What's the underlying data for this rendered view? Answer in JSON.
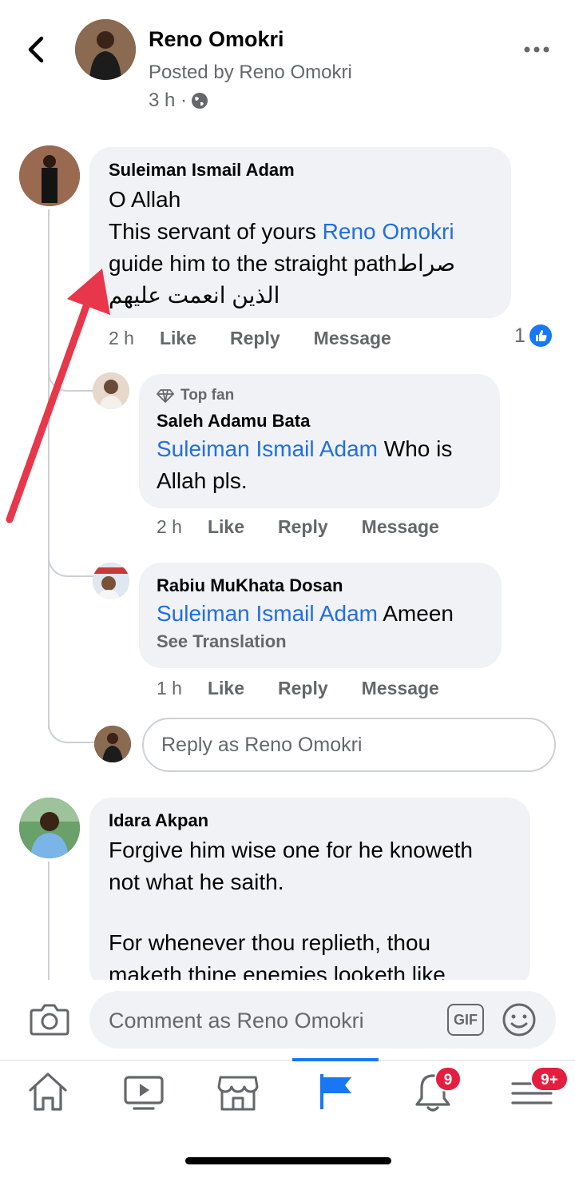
{
  "header": {
    "name": "Reno Omokri",
    "posted_by": "Posted by Reno Omokri",
    "time": "3 h ·"
  },
  "comments": [
    {
      "name": "Suleiman Ismail Adam",
      "line1": "O Allah",
      "line2_pre": "This servant of yours ",
      "line2_link": "Reno Omokri",
      "line3": "guide him to the straight pathصراط",
      "line4": "الذين انعمت عليهم",
      "time": "2 h",
      "like": "Like",
      "reply": "Reply",
      "message": "Message",
      "like_count": "1"
    },
    {
      "top_fan": "Top fan",
      "name": "Saleh Adamu Bata",
      "mention": "Suleiman Ismail Adam",
      "text_after": " Who is",
      "text_line2": "Allah pls.",
      "time": "2 h",
      "like": "Like",
      "reply": "Reply",
      "message": "Message"
    },
    {
      "name": "Rabiu MuKhata Dosan",
      "mention": "Suleiman Ismail Adam",
      "text_after": " Ameen",
      "see_translation": "See Translation",
      "time": "1 h",
      "like": "Like",
      "reply": "Reply",
      "message": "Message"
    },
    {
      "name": "Idara Akpan",
      "line1": "Forgive him wise one for he knoweth",
      "line2": "not what he saith.",
      "line3": "For whenever thou replieth, thou",
      "line4": "maketh thine enemies looketh like"
    }
  ],
  "reply_as_placeholder": "Reply as Reno Omokri",
  "composer": {
    "placeholder": "Comment as Reno Omokri",
    "gif": "GIF"
  },
  "tabs": [
    {
      "icon": "home-icon"
    },
    {
      "icon": "video-icon"
    },
    {
      "icon": "marketplace-icon"
    },
    {
      "icon": "pages-flag-icon",
      "active": true
    },
    {
      "icon": "bell-icon",
      "badge": "9"
    },
    {
      "icon": "menu-icon",
      "badge": "9+"
    }
  ],
  "colors": {
    "accent": "#1877f2",
    "link": "#216fdb",
    "badge": "#e41e3f",
    "arrow": "#e8364a"
  }
}
